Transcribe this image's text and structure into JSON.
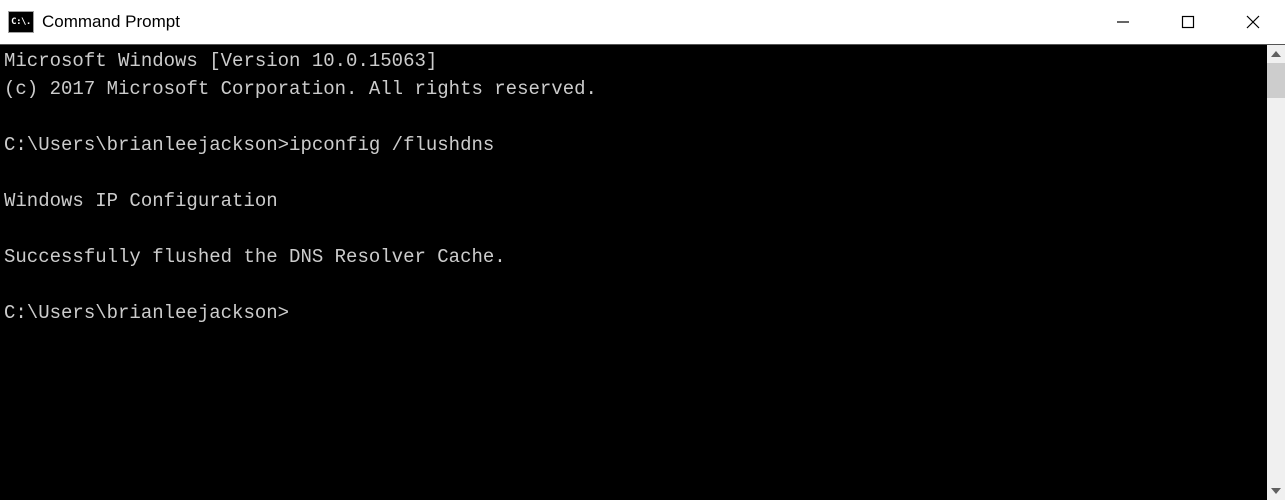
{
  "window": {
    "icon_text": "C:\\.",
    "title": "Command Prompt"
  },
  "terminal": {
    "lines": [
      "Microsoft Windows [Version 10.0.15063]",
      "(c) 2017 Microsoft Corporation. All rights reserved.",
      "",
      "C:\\Users\\brianleejackson>ipconfig /flushdns",
      "",
      "Windows IP Configuration",
      "",
      "Successfully flushed the DNS Resolver Cache.",
      "",
      "C:\\Users\\brianleejackson>"
    ]
  }
}
